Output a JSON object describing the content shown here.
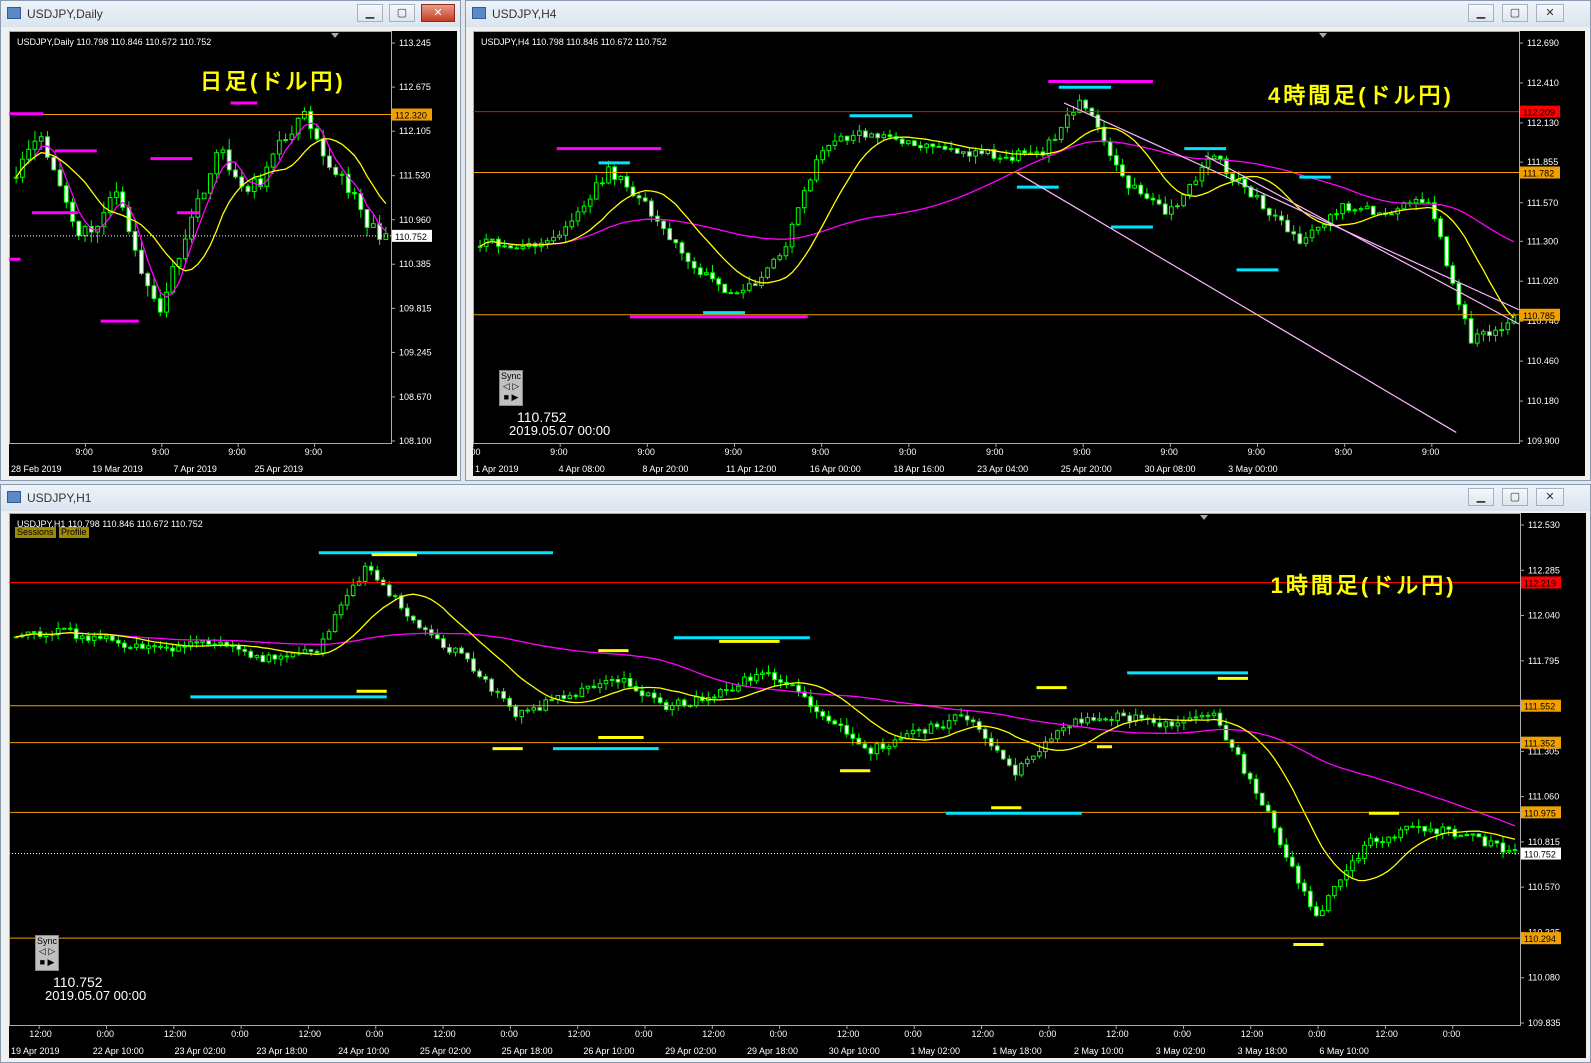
{
  "windows": {
    "daily": {
      "title": "USDJPY,Daily",
      "info": "USDJPY,Daily  110.798 110.846 110.672 110.752",
      "annotation": "日足(ドル円)",
      "y_ticks": [
        "113.245",
        "112.675",
        "112.105",
        "111.530",
        "110.960",
        "110.385",
        "109.815",
        "109.245",
        "108.670",
        "108.100"
      ],
      "price_tags": [
        {
          "text": "112.320",
          "color": "#f0a000"
        },
        {
          "text": "110.752",
          "color": "#ffffff"
        }
      ],
      "time_ticks": [
        "9:00",
        "9:00",
        "9:00",
        "9:00"
      ],
      "date_ticks": [
        "28 Feb 2019",
        "19 Mar 2019",
        "7 Apr 2019",
        "25 Apr 2019"
      ]
    },
    "h4": {
      "title": "USDJPY,H4",
      "info": "USDJPY,H4  110.798 110.846 110.672 110.752",
      "annotation": "4時間足(ドル円)",
      "y_ticks": [
        "112.690",
        "112.410",
        "112.130",
        "111.855",
        "111.570",
        "111.300",
        "111.020",
        "110.740",
        "110.460",
        "110.180",
        "109.900"
      ],
      "price_tags": [
        {
          "text": "112.209",
          "color": "#ff0000"
        },
        {
          "text": "111.782",
          "color": "#f0a000"
        },
        {
          "text": "110.785",
          "color": "#f0a000"
        }
      ],
      "time_ticks": [
        "9:00",
        "9:00",
        "9:00",
        "9:00",
        "9:00",
        "9:00",
        "9:00",
        "9:00",
        "9:00",
        "9:00",
        "9:00",
        "9:00"
      ],
      "date_ticks": [
        "1 Apr 2019",
        "4 Apr 08:00",
        "8 Apr 20:00",
        "11 Apr 12:00",
        "16 Apr 00:00",
        "18 Apr 16:00",
        "23 Apr 04:00",
        "25 Apr 20:00",
        "30 Apr 08:00",
        "3 May 00:00"
      ],
      "sync": {
        "label": "Sync",
        "price": "110.752",
        "date": "2019.05.07 00:00"
      }
    },
    "h1": {
      "title": "USDJPY,H1",
      "info": "USDJPY,H1  110.798 110.846 110.672 110.752",
      "annotation": "1時間足(ドル円)",
      "buttons": [
        "Sessions",
        "Profile"
      ],
      "y_ticks": [
        "112.530",
        "112.285",
        "112.040",
        "111.795",
        "111.550",
        "111.305",
        "111.060",
        "110.815",
        "110.570",
        "110.325",
        "110.080",
        "109.835"
      ],
      "price_tags": [
        {
          "text": "112.219",
          "color": "#ff0000"
        },
        {
          "text": "111.552",
          "color": "#f0a000"
        },
        {
          "text": "111.352",
          "color": "#f0a000"
        },
        {
          "text": "110.975",
          "color": "#f0a000"
        },
        {
          "text": "110.752",
          "color": "#ffffff"
        },
        {
          "text": "110.294",
          "color": "#f0a000"
        }
      ],
      "time_ticks": [
        "12:00",
        "0:00",
        "12:00",
        "0:00",
        "12:00",
        "0:00",
        "12:00",
        "0:00",
        "12:00",
        "0:00",
        "12:00",
        "0:00",
        "12:00",
        "0:00",
        "12:00",
        "0:00",
        "12:00",
        "0:00",
        "12:00",
        "0:00",
        "12:00",
        "0:00"
      ],
      "date_ticks": [
        "19 Apr 2019",
        "22 Apr 10:00",
        "23 Apr 02:00",
        "23 Apr 18:00",
        "24 Apr 10:00",
        "25 Apr 02:00",
        "25 Apr 18:00",
        "26 Apr 10:00",
        "29 Apr 02:00",
        "29 Apr 18:00",
        "30 Apr 10:00",
        "1 May 02:00",
        "1 May 18:00",
        "2 May 10:00",
        "3 May 02:00",
        "3 May 18:00",
        "6 May 10:00"
      ],
      "sync": {
        "label": "Sync",
        "price": "110.752",
        "date": "2019.05.07 00:00"
      }
    }
  },
  "colors": {
    "candle": "#00ff00",
    "ma_fast": "#ffff00",
    "ma_slow": "#ff00ff",
    "resistance": "#ff0000",
    "support": "#f0a000",
    "marker_magenta": "#ff00ff",
    "marker_cyan": "#00e5ff",
    "marker_yellow": "#ffff00",
    "channel": "#ffb6ff",
    "annotation": "#ffff00"
  }
}
